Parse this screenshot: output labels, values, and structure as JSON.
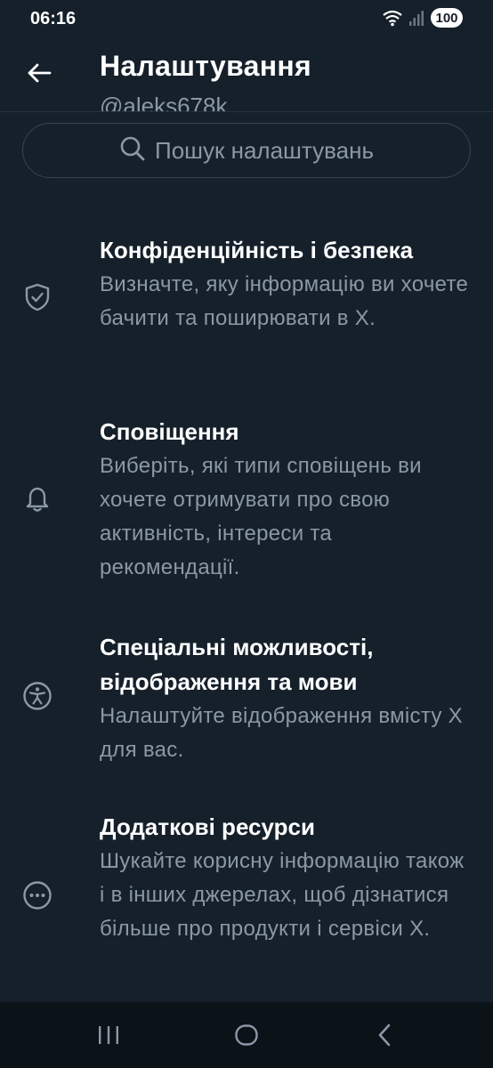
{
  "status_bar": {
    "time": "06:16",
    "battery": "100",
    "icons": [
      "wifi-icon",
      "signal-icon",
      "battery-icon"
    ]
  },
  "header": {
    "title": "Налаштування",
    "handle": "@aleks678k",
    "back_icon": "arrow-left-icon"
  },
  "search": {
    "placeholder": "Пошук налаштувань",
    "icon": "search-icon"
  },
  "items": [
    {
      "icon": "shield-icon",
      "title": "Конфіденційність і безпека",
      "description": "Визначте, яку інформацію ви хочете бачити та поширювати в X."
    },
    {
      "icon": "bell-icon",
      "title": "Сповіщення",
      "description": "Виберіть, які типи сповіщень ви хочете отримувати про свою активність, інтереси та рекомендації."
    },
    {
      "icon": "accessibility-icon",
      "title": "Спеціальні можливості, відображення та мови",
      "description": "Налаштуйте відображення вмісту X для вас."
    },
    {
      "icon": "more-circle-icon",
      "title": "Додаткові ресурси",
      "description": "Шукайте корисну інформацію також і в інших джерелах, щоб дізнатися більше про продукти і сервіси X."
    }
  ],
  "navbar": {
    "icons": [
      "recent-apps-icon",
      "home-icon",
      "back-icon"
    ]
  },
  "colors": {
    "background": "#15202b",
    "primary_text": "#ffffff",
    "secondary_text": "#8b98a5",
    "border": "#38444d"
  }
}
